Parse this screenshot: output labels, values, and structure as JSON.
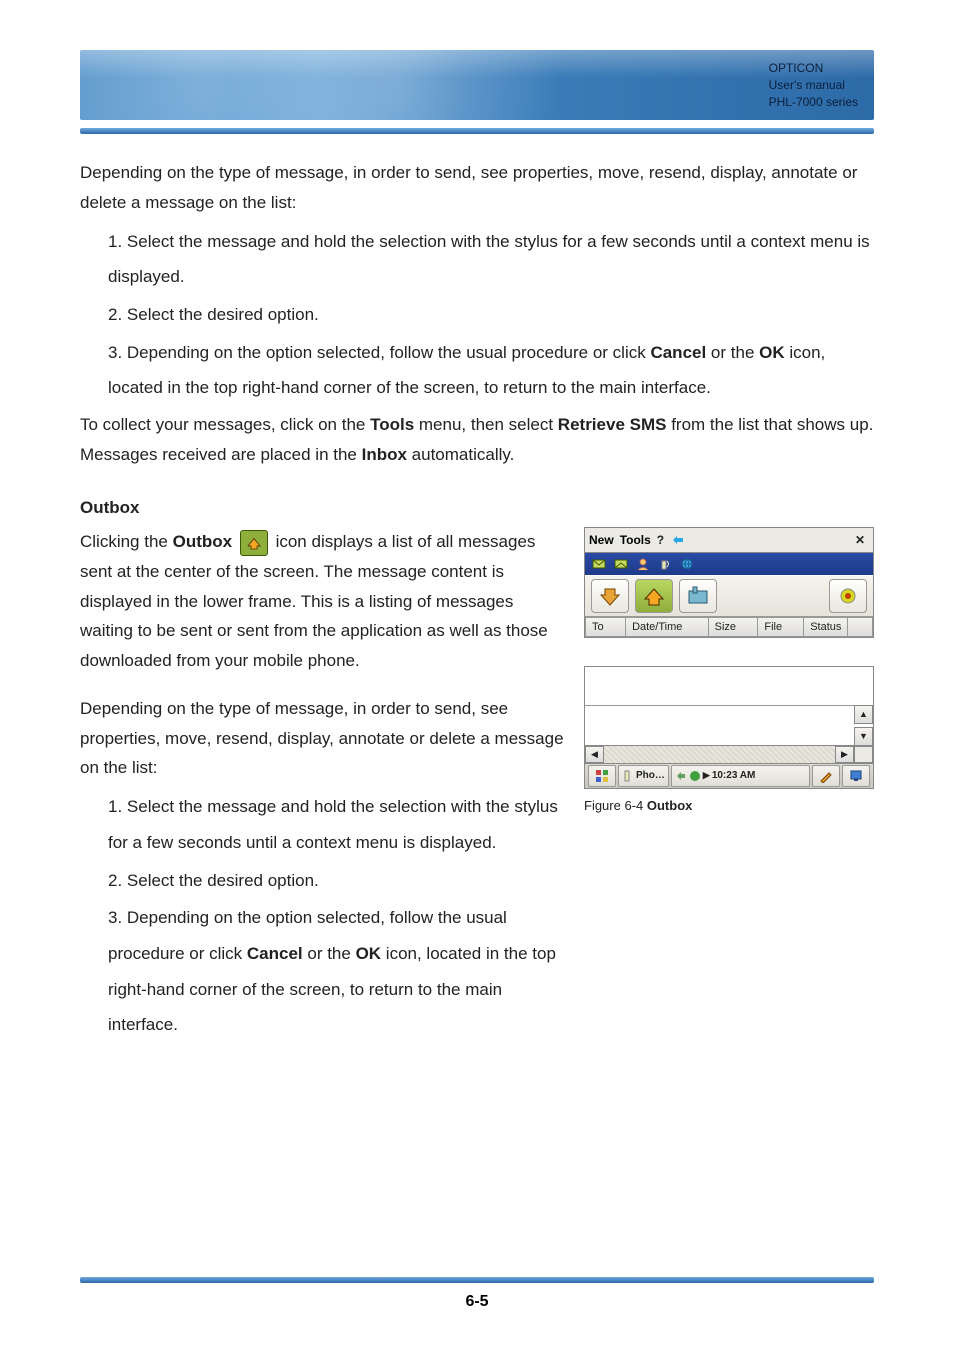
{
  "header": {
    "line1": "OPTICON",
    "line2": "User's manual",
    "line3": "PHL-7000 series"
  },
  "intro1": "Depending on the type of message, in order to send, see properties, move, resend, display, annotate or delete a message on the list:",
  "step1": "1. Select the message and hold the selection with the stylus for a few seconds until a context menu is displayed.",
  "step2": "2. Select the desired option.",
  "step3a": "3. Depending on the option selected, follow the usual procedure or click ",
  "step3_cancel": "Cancel",
  "step3b": " or the ",
  "step3_ok": "OK",
  "step3c": " icon, located in the top right-hand corner of the screen, to return to the main interface.",
  "collect1": "To collect your messages, click on the ",
  "tools_bold": "Tools",
  "collect2": " menu, then select ",
  "retrieve_bold": "Retrieve SMS",
  "collect3": " from the list that shows up. Messages received are placed in the ",
  "inbox_bold": "Inbox",
  "collect4": " automatically.",
  "outbox_heading": "Outbox",
  "outbox_p1a": "Clicking the ",
  "outbox_bold": "Outbox",
  "outbox_p1b": " icon displays a list of all messages sent at the center of the screen. The message content is displayed in the lower frame. This is a listing of messages waiting to be sent or sent from the application as well as those downloaded from your mobile phone.",
  "outbox_p2": "Depending on the type of message, in order to send, see properties, move, resend, display, annotate or delete a message on the list:",
  "outbox_s1": "1. Select the message and hold the selection with the stylus for a few seconds until a context menu is displayed.",
  "outbox_s2": "2. Select the desired option.",
  "outbox_s3a": "3. Depending on the option selected, follow the usual procedure or click ",
  "outbox_s3_cancel": "Cancel",
  "outbox_s3b": " or the ",
  "outbox_s3_ok": "OK",
  "outbox_s3c": " icon, located in the top right-hand corner of the screen, to return to the main interface.",
  "screenshot1": {
    "menu_new": "New",
    "menu_tools": "Tools",
    "menu_q": "?",
    "columns": {
      "to": "To",
      "datetime": "Date/Time",
      "size": "Size",
      "file": "File",
      "status": "Status"
    }
  },
  "screenshot2": {
    "taskbar_label": "Pho…",
    "time": "10:23 AM"
  },
  "figure_caption_a": "Figure 6-4 ",
  "figure_caption_b": "Outbox",
  "page_number": "6-5"
}
